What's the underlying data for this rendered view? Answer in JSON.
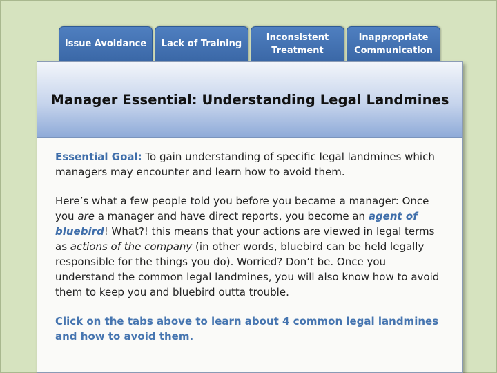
{
  "tabs": [
    {
      "line1": "Issue Avoidance",
      "line2": ""
    },
    {
      "line1": "Lack of Training",
      "line2": ""
    },
    {
      "line1": "Inconsistent",
      "line2": "Treatment"
    },
    {
      "line1": "Inappropriate",
      "line2": "Communication"
    }
  ],
  "header": {
    "title": "Manager Essential: Understanding Legal Landmines"
  },
  "goal": {
    "label": "Essential Goal:",
    "text": " To gain understanding of specific legal landmines which managers may encounter and learn how to avoid them."
  },
  "intro": {
    "part1": "Here’s what a few people told you before you became a manager: Once you ",
    "are": "are",
    "part2": " a manager and have direct reports, you become an ",
    "agent": "agent of bluebird",
    "part3": "! What?! this means that your actions are viewed in legal terms as ",
    "actions": "actions of the company",
    "part4": " (in other words, bluebird can be held legally responsible for the things you do). Worried? Don’t be. Once you understand the common legal landmines, you will also know how to avoid them to keep you and bluebird outta trouble."
  },
  "cta": "Click on the tabs above to learn about 4 common legal landmines and how to avoid them.",
  "colors": {
    "accent": "#3f6eaa",
    "tab": "#4472b4",
    "background": "#d6e3bf"
  }
}
